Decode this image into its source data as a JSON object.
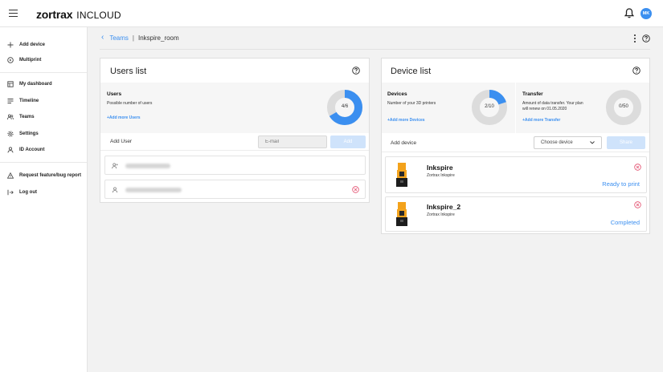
{
  "header": {
    "logo": "zortrax",
    "product": "INCLOUD",
    "avatar_initials": "MK",
    "accent": "#3b8ff0"
  },
  "sidebar": {
    "items": [
      {
        "label": "Add device",
        "icon": "plus-icon"
      },
      {
        "label": "Multiprint",
        "icon": "multiprint-icon"
      },
      {
        "label": "My dashboard",
        "icon": "dashboard-icon"
      },
      {
        "label": "Timeline",
        "icon": "timeline-icon"
      },
      {
        "label": "Teams",
        "icon": "teams-icon"
      },
      {
        "label": "Settings",
        "icon": "gear-icon"
      },
      {
        "label": "ID Account",
        "icon": "user-icon"
      },
      {
        "label": "Request feature/bug report",
        "icon": "warning-icon"
      },
      {
        "label": "Log out",
        "icon": "logout-icon"
      }
    ]
  },
  "breadcrumb": {
    "parent": "Teams",
    "separator": "|",
    "current": "Inkspire_room"
  },
  "users_panel": {
    "title": "Users list",
    "stat": {
      "title": "Users",
      "description": "Possible number of users",
      "link": "+Add more Users",
      "label": "4/6",
      "used": 4,
      "total": 6
    },
    "add_label": "Add User",
    "email_placeholder": "E-mail",
    "add_button": "Add",
    "users": [
      {
        "removable": false
      },
      {
        "removable": true
      }
    ]
  },
  "device_panel": {
    "title": "Device list",
    "devices_stat": {
      "title": "Devices",
      "description": "Number of your 3D printers",
      "link": "+Add more Devices",
      "label": "2/10",
      "used": 2,
      "total": 10
    },
    "transfer_stat": {
      "title": "Transfer",
      "description": "Amount of data transfer. Your plan will renew on 01.05.2020",
      "link": "+Add more Transfer",
      "label": "0/50",
      "used": 0,
      "total": 50
    },
    "add_label": "Add device",
    "select_placeholder": "Choose device",
    "share_button": "Share",
    "devices": [
      {
        "name": "Inkspire",
        "model": "Zortrax Inkspire",
        "status": "Ready to print"
      },
      {
        "name": "Inkspire_2",
        "model": "Zortrax Inkspire",
        "status": "Completed"
      }
    ]
  }
}
